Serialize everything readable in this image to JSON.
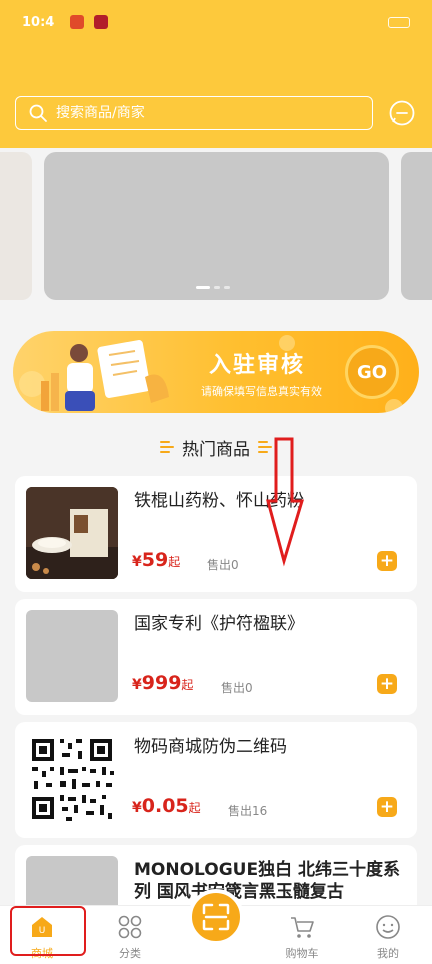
{
  "status_bar": {
    "time": "10:4"
  },
  "search": {
    "placeholder": "搜索商品/商家"
  },
  "banner": {
    "active_dot": 0,
    "dot_count": 3
  },
  "promo": {
    "title": "入驻审核",
    "subtitle": "请确保填写信息真实有效",
    "go_label": "GO"
  },
  "section": {
    "title": "热门商品"
  },
  "products": [
    {
      "name": "铁棍山药粉、怀山药粉",
      "yen": "¥",
      "price": "59",
      "qi": "起",
      "sold": "售出0"
    },
    {
      "name": "国家专利《护符楹联》",
      "yen": "¥",
      "price": "999",
      "qi": "起",
      "sold": "售出0"
    },
    {
      "name": "物码商城防伪二维码",
      "yen": "¥",
      "price": "0.05",
      "qi": "起",
      "sold": "售出16"
    },
    {
      "name": "MONOLOGUE独白 北纬三十度系列 国风书宏箴言黑玉髓复古"
    }
  ],
  "tabbar": {
    "items": [
      {
        "label": "商城",
        "active": true
      },
      {
        "label": "分类"
      },
      {
        "label": "购物车"
      },
      {
        "label": "我的"
      }
    ]
  },
  "colors": {
    "brand_yellow": "#fdc93c",
    "accent_orange": "#f7a919",
    "price_red": "#d8241b",
    "annotation_red": "#e01d1d"
  }
}
